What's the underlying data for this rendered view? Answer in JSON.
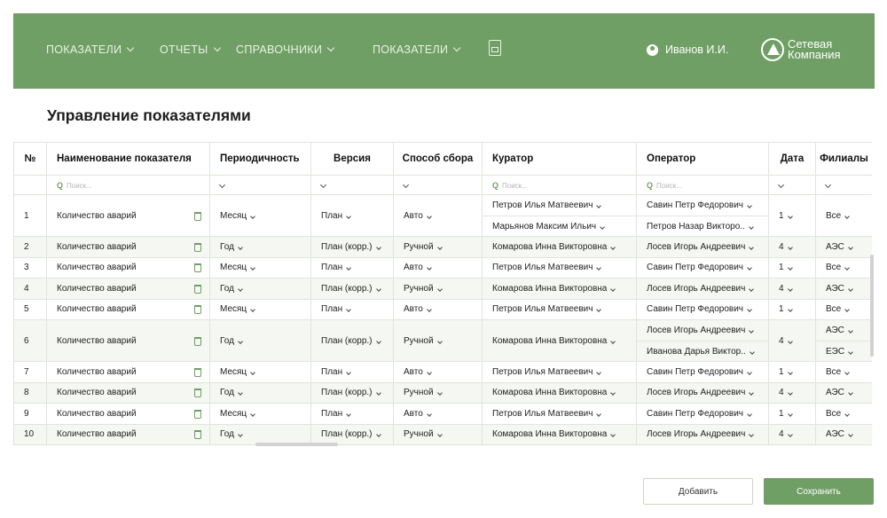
{
  "header": {
    "nav": [
      {
        "label": "ПОКАЗАТЕЛИ"
      },
      {
        "label": "ОТЧЕТЫ"
      },
      {
        "label": "СПРАВОЧНИКИ"
      },
      {
        "label": "ПОКАЗАТЕЛИ"
      }
    ],
    "doc_icon": "document-icon",
    "user_name": "Иванов И.И.",
    "logo_line1": "Сетевая",
    "logo_line2": "Компания"
  },
  "page_title": "Управление показателями",
  "table": {
    "columns": [
      "№",
      "Наименование показателя",
      "Периодичность",
      "Версия",
      "Способ сбора",
      "Куратор",
      "Оператор",
      "Дата",
      "Филиалы"
    ],
    "search_placeholder": "Поиск...",
    "rows": [
      {
        "num": "1",
        "name": "Количество аварий",
        "period": "Месяц",
        "version": "План",
        "method": "Авто",
        "curator": [
          "Петров Илья Матвеевич",
          "Марьянов Максим Ильич"
        ],
        "operator": [
          "Савин Петр Федорович",
          "Петров Назар Викторо.."
        ],
        "date": "1",
        "branch": [
          "Все"
        ]
      },
      {
        "num": "2",
        "name": "Количество аварий",
        "period": "Год",
        "version": "План (корр.)",
        "method": "Ручной",
        "curator": [
          "Комарова Инна Викторовна"
        ],
        "operator": [
          "Лосев Игорь Андреевич"
        ],
        "date": "4",
        "branch": [
          "АЭС"
        ]
      },
      {
        "num": "3",
        "name": "Количество аварий",
        "period": "Месяц",
        "version": "План",
        "method": "Авто",
        "curator": [
          "Петров Илья Матвеевич"
        ],
        "operator": [
          "Савин Петр Федорович"
        ],
        "date": "1",
        "branch": [
          "Все"
        ]
      },
      {
        "num": "4",
        "name": "Количество аварий",
        "period": "Год",
        "version": "План (корр.)",
        "method": "Ручной",
        "curator": [
          "Комарова Инна Викторовна"
        ],
        "operator": [
          "Лосев Игорь Андреевич"
        ],
        "date": "4",
        "branch": [
          "АЭС"
        ]
      },
      {
        "num": "5",
        "name": "Количество аварий",
        "period": "Месяц",
        "version": "План",
        "method": "Авто",
        "curator": [
          "Петров Илья Матвеевич"
        ],
        "operator": [
          "Савин Петр Федорович"
        ],
        "date": "1",
        "branch": [
          "Все"
        ]
      },
      {
        "num": "6",
        "name": "Количество аварий",
        "period": "Год",
        "version": "План (корр.)",
        "method": "Ручной",
        "curator": [
          "Комарова Инна Викторовна"
        ],
        "operator": [
          "Лосев Игорь Андреевич",
          "Иванова Дарья Виктор.."
        ],
        "date": "4",
        "branch": [
          "АЭС",
          "ЕЭС"
        ]
      },
      {
        "num": "7",
        "name": "Количество аварий",
        "period": "Месяц",
        "version": "План",
        "method": "Авто",
        "curator": [
          "Петров Илья Матвеевич"
        ],
        "operator": [
          "Савин Петр Федорович"
        ],
        "date": "1",
        "branch": [
          "Все"
        ]
      },
      {
        "num": "8",
        "name": "Количество аварий",
        "period": "Год",
        "version": "План (корр.)",
        "method": "Ручной",
        "curator": [
          "Комарова Инна Викторовна"
        ],
        "operator": [
          "Лосев Игорь Андреевич"
        ],
        "date": "4",
        "branch": [
          "АЭС"
        ]
      },
      {
        "num": "9",
        "name": "Количество аварий",
        "period": "Месяц",
        "version": "План",
        "method": "Авто",
        "curator": [
          "Петров Илья Матвеевич"
        ],
        "operator": [
          "Савин Петр Федорович"
        ],
        "date": "1",
        "branch": [
          "Все"
        ]
      },
      {
        "num": "10",
        "name": "Количество аварий",
        "period": "Год",
        "version": "План (корр.)",
        "method": "Ручной",
        "curator": [
          "Комарова Инна Викторовна"
        ],
        "operator": [
          "Лосев Игорь Андреевич"
        ],
        "date": "4",
        "branch": [
          "АЭС"
        ]
      }
    ]
  },
  "buttons": {
    "add": "Добавить",
    "save": "Сохранить"
  },
  "colors": {
    "brand": "#6f9f64",
    "row_alt": "#f4f7f2"
  }
}
